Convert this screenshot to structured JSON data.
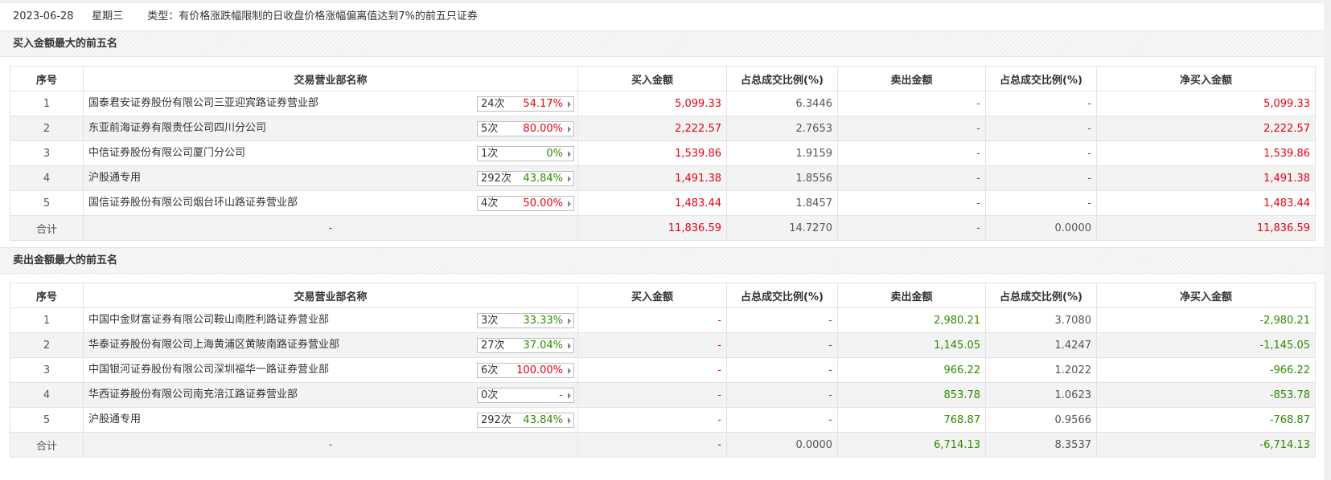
{
  "header": {
    "date": "2023-06-28",
    "weekday": "星期三",
    "type_text": "类型：有价格涨跌幅限制的日收盘价格涨幅偏离值达到7%的前五只证券"
  },
  "columns": [
    "序号",
    "交易营业部名称",
    "买入金额",
    "占总成交比例(%)",
    "卖出金额",
    "占总成交比例(%)",
    "净买入金额"
  ],
  "buy_section": {
    "title": "买入金额最大的前五名",
    "rows": [
      {
        "idx": "1",
        "name": "国泰君安证券股份有限公司三亚迎宾路证券营业部",
        "count": "24次",
        "pct": "54.17%",
        "pct_color": "red",
        "buy": "5,099.33",
        "buy_ratio": "6.3446",
        "sell": "-",
        "sell_ratio": "-",
        "net": "5,099.33",
        "net_color": "red"
      },
      {
        "idx": "2",
        "name": "东亚前海证券有限责任公司四川分公司",
        "count": "5次",
        "pct": "80.00%",
        "pct_color": "red",
        "buy": "2,222.57",
        "buy_ratio": "2.7653",
        "sell": "-",
        "sell_ratio": "-",
        "net": "2,222.57",
        "net_color": "red"
      },
      {
        "idx": "3",
        "name": "中信证券股份有限公司厦门分公司",
        "count": "1次",
        "pct": "0%",
        "pct_color": "green",
        "buy": "1,539.86",
        "buy_ratio": "1.9159",
        "sell": "-",
        "sell_ratio": "-",
        "net": "1,539.86",
        "net_color": "red"
      },
      {
        "idx": "4",
        "name": "沪股通专用",
        "count": "292次",
        "pct": "43.84%",
        "pct_color": "green",
        "buy": "1,491.38",
        "buy_ratio": "1.8556",
        "sell": "-",
        "sell_ratio": "-",
        "net": "1,491.38",
        "net_color": "red"
      },
      {
        "idx": "5",
        "name": "国信证券股份有限公司烟台环山路证券营业部",
        "count": "4次",
        "pct": "50.00%",
        "pct_color": "red",
        "buy": "1,483.44",
        "buy_ratio": "1.8457",
        "sell": "-",
        "sell_ratio": "-",
        "net": "1,483.44",
        "net_color": "red"
      }
    ],
    "total": {
      "label": "合计",
      "name": "-",
      "buy": "11,836.59",
      "buy_ratio": "14.7270",
      "sell": "-",
      "sell_ratio": "0.0000",
      "net": "11,836.59",
      "net_color": "red"
    }
  },
  "sell_section": {
    "title": "卖出金额最大的前五名",
    "rows": [
      {
        "idx": "1",
        "name": "中国中金财富证券有限公司鞍山南胜利路证券营业部",
        "count": "3次",
        "pct": "33.33%",
        "pct_color": "green",
        "buy": "-",
        "buy_ratio": "-",
        "sell": "2,980.21",
        "sell_ratio": "3.7080",
        "net": "-2,980.21",
        "net_color": "green"
      },
      {
        "idx": "2",
        "name": "华泰证券股份有限公司上海黄浦区黄陂南路证券营业部",
        "count": "27次",
        "pct": "37.04%",
        "pct_color": "green",
        "buy": "-",
        "buy_ratio": "-",
        "sell": "1,145.05",
        "sell_ratio": "1.4247",
        "net": "-1,145.05",
        "net_color": "green"
      },
      {
        "idx": "3",
        "name": "中国银河证券股份有限公司深圳福华一路证券营业部",
        "count": "6次",
        "pct": "100.00%",
        "pct_color": "red",
        "buy": "-",
        "buy_ratio": "-",
        "sell": "966.22",
        "sell_ratio": "1.2022",
        "net": "-966.22",
        "net_color": "green"
      },
      {
        "idx": "4",
        "name": "华西证券股份有限公司南充涪江路证券营业部",
        "count": "0次",
        "pct": "-",
        "pct_color": "gray",
        "buy": "-",
        "buy_ratio": "-",
        "sell": "853.78",
        "sell_ratio": "1.0623",
        "net": "-853.78",
        "net_color": "green"
      },
      {
        "idx": "5",
        "name": "沪股通专用",
        "count": "292次",
        "pct": "43.84%",
        "pct_color": "green",
        "buy": "-",
        "buy_ratio": "-",
        "sell": "768.87",
        "sell_ratio": "0.9566",
        "net": "-768.87",
        "net_color": "green"
      }
    ],
    "total": {
      "label": "合计",
      "name": "-",
      "buy": "-",
      "buy_ratio": "0.0000",
      "sell": "6,714.13",
      "sell_ratio": "8.3537",
      "net": "-6,714.13",
      "net_color": "green"
    }
  },
  "colors": {
    "red": "#e60012",
    "green": "#2f8a00",
    "border": "#e3e3e3",
    "alt_row": "#f3f3f3"
  }
}
